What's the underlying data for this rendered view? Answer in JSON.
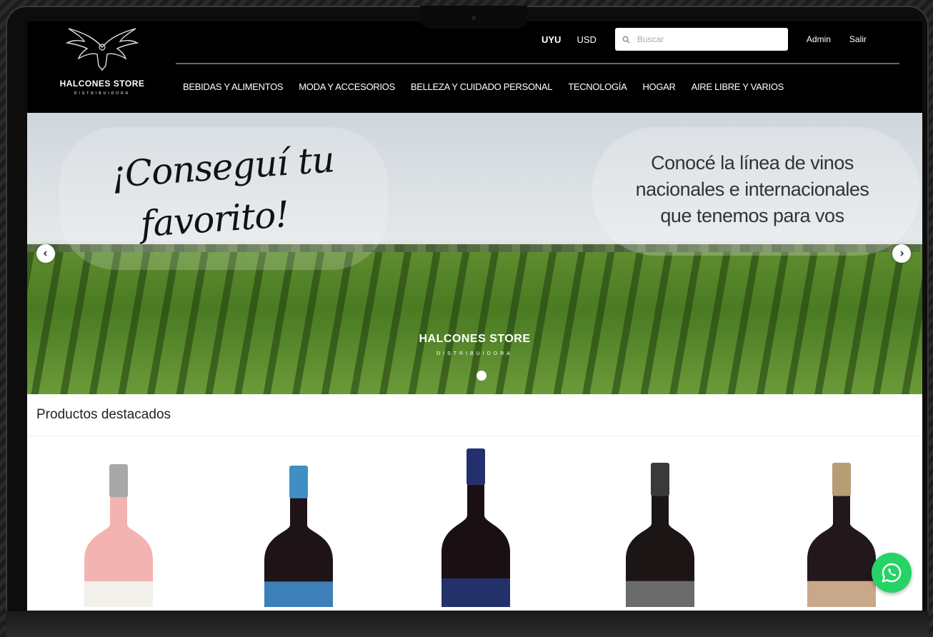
{
  "brand": {
    "name": "HALCONES STORE",
    "subtitle": "DISTRIBUIDORA"
  },
  "currency": {
    "options": [
      "UYU",
      "USD"
    ],
    "selected": "UYU"
  },
  "search": {
    "placeholder": "Buscar",
    "value": ""
  },
  "account": {
    "admin_label": "Admin",
    "logout_label": "Salir"
  },
  "nav": {
    "items": [
      "BEBIDAS Y ALIMENTOS",
      "MODA Y ACCESORIOS",
      "BELLEZA Y CUIDADO PERSONAL",
      "TECNOLOGÍA",
      "HOGAR",
      "AIRE LIBRE Y VARIOS"
    ]
  },
  "hero": {
    "headline_line1": "¡Conseguí tu",
    "headline_line2": "favorito!",
    "tagline_line1": "Conocé la línea de vinos",
    "tagline_line2": "nacionales e internacionales",
    "tagline_line3": "que tenemos para vos",
    "brand_name": "HALCONES STORE",
    "brand_subtitle": "DISTRIBUIDORA",
    "prev_icon": "chevron-left-icon",
    "next_icon": "chevron-right-icon"
  },
  "featured": {
    "title": "Productos destacados",
    "products": [
      {
        "kind": "rose wine bottle",
        "capsule": "#a8a8a8",
        "glass": "#f3b3b0",
        "label": "#f2f0ea"
      },
      {
        "kind": "red wine bottle",
        "capsule": "#3f8fc4",
        "glass": "#1e1418",
        "label": "#3d7fb8"
      },
      {
        "kind": "red wine bottle",
        "capsule": "#24306e",
        "glass": "#1a1014",
        "label": "#23306a"
      },
      {
        "kind": "red wine bottle",
        "capsule": "#3a3a3a",
        "glass": "#1b1516",
        "label": "#6b6b6b"
      },
      {
        "kind": "red wine bottle",
        "capsule": "#b89c74",
        "glass": "#22171a",
        "label": "#c9a88a"
      }
    ]
  },
  "whatsapp": {
    "icon": "whatsapp-icon",
    "color": "#25d366"
  }
}
